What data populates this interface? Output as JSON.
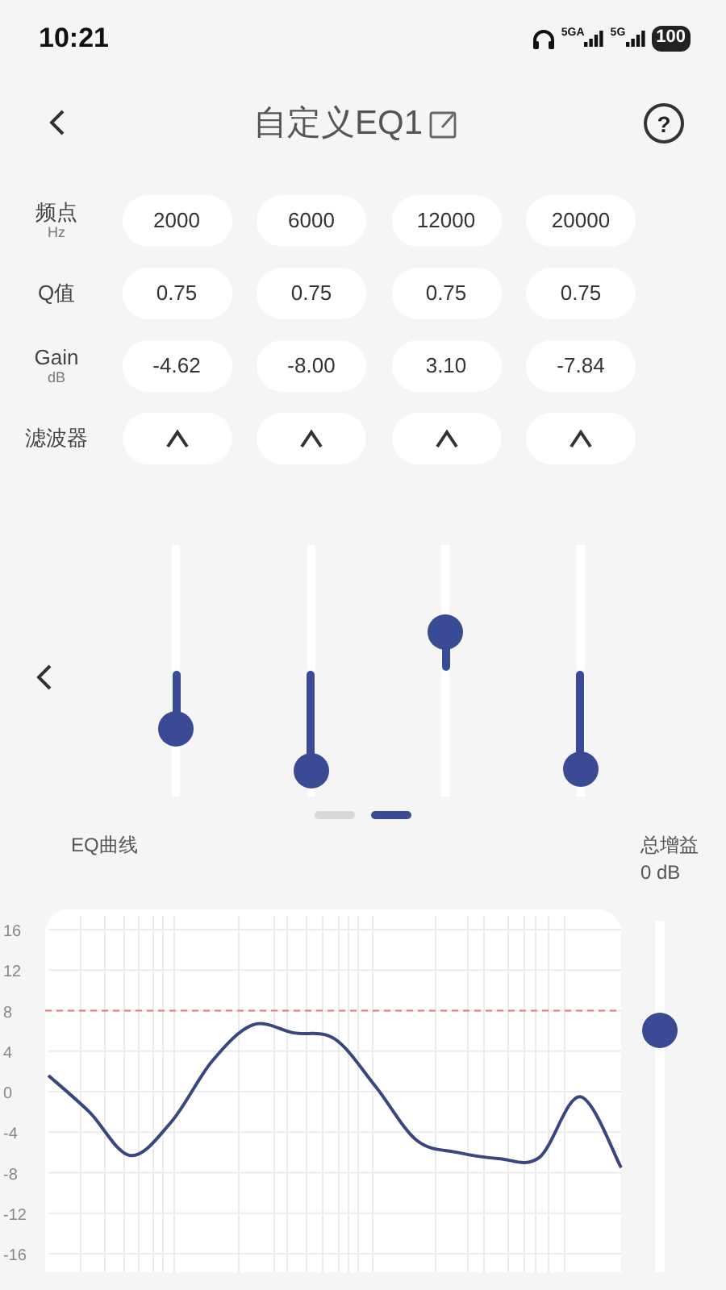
{
  "status_bar": {
    "time": "10:21",
    "networks": [
      "5GA",
      "5G"
    ],
    "battery": "100"
  },
  "header": {
    "title": "自定义EQ1",
    "help": "?"
  },
  "row_labels": [
    {
      "label": "频点",
      "unit": "Hz"
    },
    {
      "label": "Q值"
    },
    {
      "label": "Gain",
      "unit": "dB"
    },
    {
      "label": "滤波器"
    }
  ],
  "bands": [
    {
      "frequency": "2000",
      "q": "0.75",
      "gain": "-4.62",
      "level": 0.27
    },
    {
      "frequency": "6000",
      "q": "0.75",
      "gain": "-8.00",
      "level": 0.1
    },
    {
      "frequency": "12000",
      "q": "0.75",
      "gain": "3.10",
      "level": 0.655
    },
    {
      "frequency": "20000",
      "q": "0.75",
      "gain": "-7.84",
      "level": 0.11
    }
  ],
  "pages": [
    {
      "selected": false
    },
    {
      "selected": true
    }
  ],
  "curve_section": {
    "title": "EQ曲线",
    "chart_data": {
      "type": "line",
      "ylim": [
        -16,
        16
      ],
      "yticks": [
        16,
        12,
        8,
        4,
        0,
        -4,
        -8,
        -12,
        -16
      ],
      "series": [
        {
          "color": "#3a4680",
          "values": [
            1.6,
            -2,
            -6.3,
            -3,
            3,
            6.6,
            5.8,
            5.2,
            0.5,
            -4.8,
            -6,
            -6.6,
            -6.5,
            -0.5,
            -7.5
          ]
        }
      ],
      "grid": true,
      "ref_lines": [
        {
          "axis": "y",
          "value": 8,
          "color": "#d98070"
        }
      ]
    }
  },
  "total_gain": {
    "label": "总增益",
    "value": "0 dB",
    "level": 0.69
  }
}
